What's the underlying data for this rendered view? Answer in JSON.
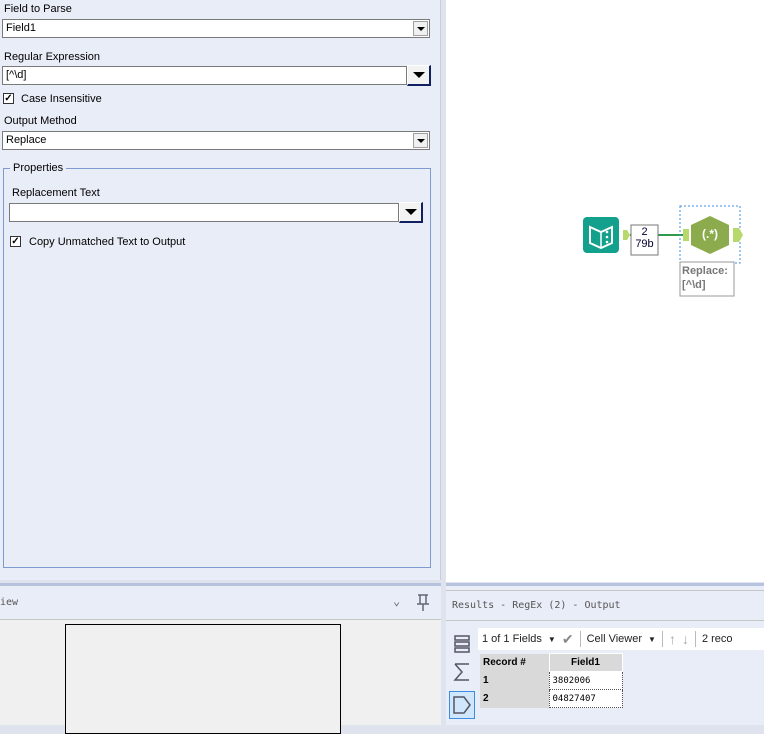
{
  "config": {
    "field_to_parse_label": "Field to Parse",
    "field_to_parse_value": "Field1",
    "regex_label": "Regular Expression",
    "regex_value": "[^\\d]",
    "case_insensitive_label": "Case Insensitive",
    "case_insensitive_checked": true,
    "output_method_label": "Output Method",
    "output_method_value": "Replace",
    "properties_title": "Properties",
    "replacement_text_label": "Replacement Text",
    "replacement_text_value": "",
    "copy_unmatched_label": "Copy Unmatched Text to Output",
    "copy_unmatched_checked": true
  },
  "canvas": {
    "connection_records": "2",
    "connection_size": "79b",
    "regex_tool_glyph": "(.*)",
    "tool_annotation_line1": "Replace:",
    "tool_annotation_line2": "[^\\d]",
    "colors": {
      "input_tool": "#13a08c",
      "regex_tool": "#8cab4c",
      "anchor": "#b7d86a",
      "connector": "#2f9a4a"
    }
  },
  "overview": {
    "title": "iew"
  },
  "results": {
    "title": "Results - RegEx (2) - Output",
    "fields_selector": "1 of 1 Fields",
    "viewer_selector": "Cell Viewer",
    "record_count": "2 reco",
    "columns": [
      "Record #",
      "Field1"
    ],
    "rows": [
      [
        "1",
        "3802006"
      ],
      [
        "2",
        "04827407"
      ]
    ]
  }
}
